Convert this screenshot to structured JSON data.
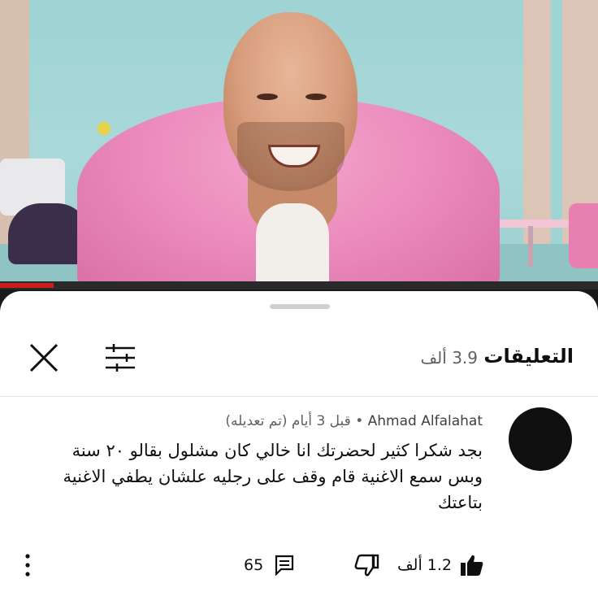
{
  "video": {
    "progress_fraction": 0.09
  },
  "comments_header": {
    "title": "التعليقات",
    "count": "3.9 ألف",
    "close_icon": "close-icon",
    "filter_icon": "sliders-icon"
  },
  "comment": {
    "author": "Ahmad Alfalahat",
    "separator": "•",
    "time": "قبل 3 أيام",
    "edited": "(تم تعديله)",
    "text_lines": [
      "بجد شكرا كثير لحضرتك انا خالي كان مشلول  بقالو ٢٠ سنة",
      "وبس سمع الاغنية قام وقف على رجليه علشان يطفي الاغنية",
      "بتاعتك"
    ],
    "likes": "1.2 ألف",
    "replies": "65",
    "like_icon": "thumbs-up-icon",
    "dislike_icon": "thumbs-down-icon",
    "reply_icon": "comment-icon",
    "more_icon": "more-vertical-icon"
  },
  "colors": {
    "accent_progress": "#c81e1e",
    "text_primary": "#0f0f0f",
    "text_secondary": "#606060"
  }
}
